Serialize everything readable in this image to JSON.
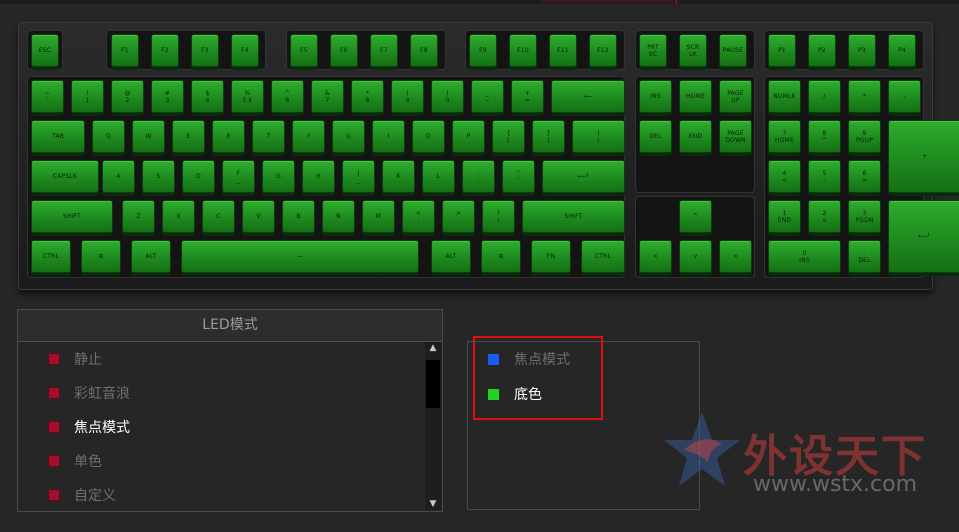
{
  "led_panel": {
    "title": "LED模式",
    "modes": [
      {
        "label": "静止",
        "active": false
      },
      {
        "label": "彩虹音浪",
        "active": false
      },
      {
        "label": "焦点模式",
        "active": true
      },
      {
        "label": "单色",
        "active": false
      },
      {
        "label": "自定义",
        "active": false
      }
    ]
  },
  "color_panel": {
    "items": [
      {
        "label": "焦点模式",
        "color": "#1a5cf0"
      },
      {
        "label": "底色",
        "color": "#22d422"
      }
    ]
  },
  "watermark": {
    "name": "外设天下",
    "url": "www.wstx.com"
  },
  "colors": {
    "key_backlight": "#2fae2f",
    "mode_swatch": "#a0102a",
    "highlight": "#e01010"
  },
  "keyboard": {
    "rows": [
      [
        {
          "label": "ESC"
        },
        {
          "label": "F1"
        },
        {
          "label": "F2"
        },
        {
          "label": "F3"
        },
        {
          "label": "F4"
        },
        {
          "label": "F5"
        },
        {
          "label": "F6"
        },
        {
          "label": "F7"
        },
        {
          "label": "F8"
        },
        {
          "label": "F9"
        },
        {
          "label": "F10"
        },
        {
          "label": "F11"
        },
        {
          "label": "F12"
        },
        {
          "label": "PRT\nSC"
        },
        {
          "label": "SCR\nLK"
        },
        {
          "label": "PAUSE"
        },
        {
          "label": "P1"
        },
        {
          "label": "P2"
        },
        {
          "label": "P3"
        },
        {
          "label": "P4"
        }
      ],
      [
        {
          "label": "~\n`"
        },
        {
          "label": "!\n1"
        },
        {
          "label": "@\n2"
        },
        {
          "label": "#\n3"
        },
        {
          "label": "$\n4"
        },
        {
          "label": "%\n5 €"
        },
        {
          "label": "^\n6"
        },
        {
          "label": "&\n7"
        },
        {
          "label": "*\n8"
        },
        {
          "label": "(\n9"
        },
        {
          "label": ")\n0"
        },
        {
          "label": "_\n-"
        },
        {
          "label": "+\n="
        },
        {
          "label": "⟵"
        },
        {
          "label": "INS"
        },
        {
          "label": "HOME"
        },
        {
          "label": "PAGE\nUP"
        },
        {
          "label": "NUMLK"
        },
        {
          "label": "/"
        },
        {
          "label": "*"
        },
        {
          "label": "-"
        }
      ],
      [
        {
          "label": "TAB"
        },
        {
          "label": "Q"
        },
        {
          "label": "W"
        },
        {
          "label": "E"
        },
        {
          "label": "R"
        },
        {
          "label": "T"
        },
        {
          "label": "Y"
        },
        {
          "label": "U"
        },
        {
          "label": "I"
        },
        {
          "label": "O"
        },
        {
          "label": "P"
        },
        {
          "label": "{\n["
        },
        {
          "label": "}\n]"
        },
        {
          "label": "|\n\\"
        },
        {
          "label": "DEL"
        },
        {
          "label": "END"
        },
        {
          "label": "PAGE\nDOWN"
        },
        {
          "label": "7\nHOME"
        },
        {
          "label": "8\n^"
        },
        {
          "label": "9\nPGUP"
        },
        {
          "label": "+"
        }
      ],
      [
        {
          "label": "CAPSLK"
        },
        {
          "label": "A"
        },
        {
          "label": "S"
        },
        {
          "label": "D"
        },
        {
          "label": "F\n_"
        },
        {
          "label": "G"
        },
        {
          "label": "H"
        },
        {
          "label": "J\n_"
        },
        {
          "label": "K"
        },
        {
          "label": "L"
        },
        {
          "label": ":\n;"
        },
        {
          "label": "\"\n'"
        },
        {
          "label": "⟵┘"
        },
        {
          "label": "4\n<"
        },
        {
          "label": "5\n-"
        },
        {
          "label": "6\n>"
        }
      ],
      [
        {
          "label": "SHIFT"
        },
        {
          "label": "Z"
        },
        {
          "label": "X"
        },
        {
          "label": "C"
        },
        {
          "label": "V"
        },
        {
          "label": "B"
        },
        {
          "label": "N"
        },
        {
          "label": "M"
        },
        {
          "label": "<\n,"
        },
        {
          "label": ">\n."
        },
        {
          "label": "?\n/"
        },
        {
          "label": "SHIFT"
        },
        {
          "label": "^"
        },
        {
          "label": "1\nEND"
        },
        {
          "label": "2\nv"
        },
        {
          "label": "3\nPGDN"
        },
        {
          "label": "⟵┘"
        }
      ],
      [
        {
          "label": "CTRL"
        },
        {
          "label": "⊞"
        },
        {
          "label": "ALT"
        },
        {
          "label": "—"
        },
        {
          "label": "ALT"
        },
        {
          "label": "⊞"
        },
        {
          "label": "FN"
        },
        {
          "label": "CTRL"
        },
        {
          "label": "<"
        },
        {
          "label": "v"
        },
        {
          "label": ">"
        },
        {
          "label": "0\nINS"
        },
        {
          "label": ".\nDEL"
        }
      ]
    ]
  }
}
